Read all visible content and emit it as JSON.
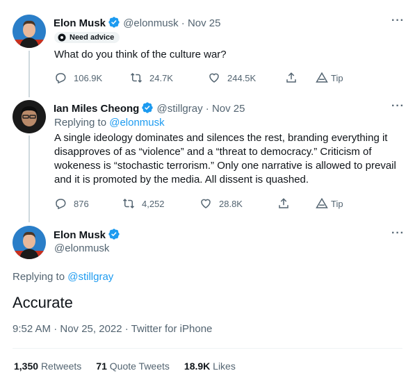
{
  "tweets": [
    {
      "name": "Elon Musk",
      "handle": "@elonmusk",
      "date": "Nov 25",
      "badge": "Need advice",
      "text": "What do you think of the culture war?",
      "replies": "106.9K",
      "retweets": "24.7K",
      "likes": "244.5K",
      "tip": "Tip"
    },
    {
      "name": "Ian Miles Cheong",
      "handle": "@stillgray",
      "date": "Nov 25",
      "replying_prefix": "Replying to",
      "replying_to": "@elonmusk",
      "text_lines": [
        "A single ideology dominates and silences the rest, branding everything it",
        "disapproves of as “violence” and a “threat to democracy.” Criticism of",
        "wokeness is “stochastic terrorism.” Only one narrative is allowed to prevail",
        "and it is promoted by the media. All dissent is quashed."
      ],
      "replies": "876",
      "retweets": "4,252",
      "likes": "28.8K",
      "tip": "Tip"
    }
  ],
  "main_tweet": {
    "name": "Elon Musk",
    "handle": "@elonmusk",
    "replying_prefix": "Replying to",
    "replying_to": "@stillgray",
    "text": "Accurate",
    "timestamp": "9:52 AM · Nov 25, 2022 · Twitter for iPhone",
    "stats": {
      "retweets_count": "1,350",
      "retweets_label": "Retweets",
      "quotes_count": "71",
      "quotes_label": "Quote Tweets",
      "likes_count": "18.9K",
      "likes_label": "Likes"
    }
  },
  "more_label": "···",
  "colors": {
    "accent": "#1d9bf0",
    "secondary_text": "#536471",
    "divider": "#eff3f4"
  }
}
